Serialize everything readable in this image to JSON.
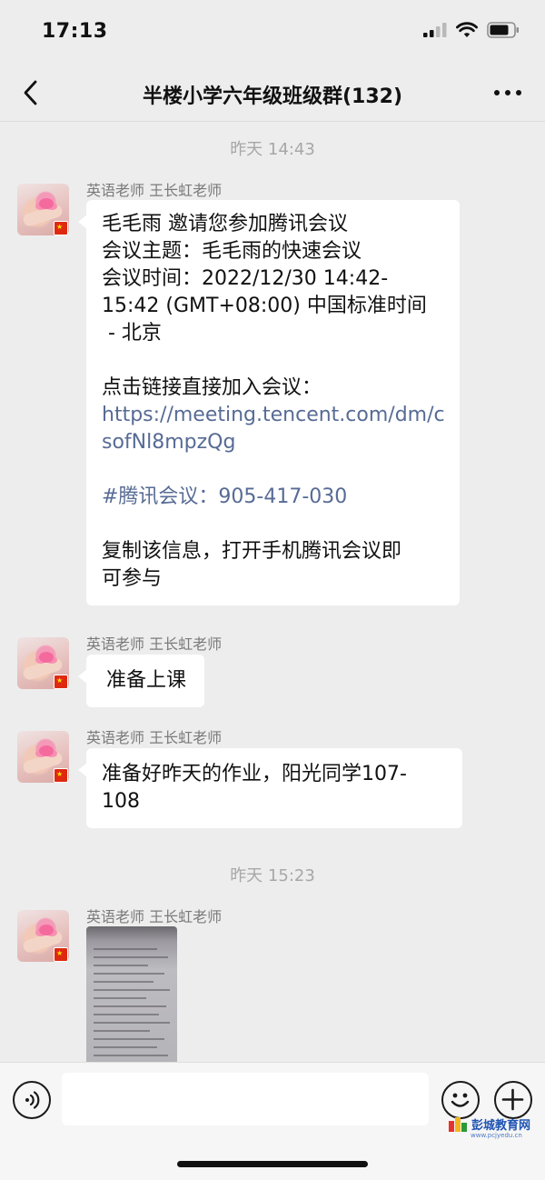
{
  "status_bar": {
    "time": "17:13"
  },
  "header": {
    "title": "半楼小学六年级班级群(132)"
  },
  "messages": [
    {
      "type": "time",
      "text": "昨天 14:43"
    },
    {
      "type": "text",
      "sender": "英语老师 王长虹老师",
      "lines": [
        "毛毛雨 邀请您参加腾讯会议",
        "会议主题：毛毛雨的快速会议",
        "会议时间：2022/12/30 14:42-",
        "15:42 (GMT+08:00) 中国标准时间",
        " - 北京",
        "",
        "点击链接直接加入会议：",
        "https://meeting.tencent.com/dm/c",
        "sofNl8mpzQg",
        "",
        "#腾讯会议：905-417-030",
        "",
        "复制该信息，打开手机腾讯会议即",
        "可参与"
      ]
    },
    {
      "type": "text",
      "sender": "英语老师 王长虹老师",
      "lines": [
        "准备上课"
      ]
    },
    {
      "type": "text",
      "sender": "英语老师 王长虹老师",
      "lines": [
        "准备好昨天的作业，阳光同学107-",
        "108"
      ]
    },
    {
      "type": "time",
      "text": "昨天 15:23"
    },
    {
      "type": "image",
      "sender": "英语老师 王长虹老师"
    }
  ],
  "input": {
    "placeholder": ""
  },
  "watermark": {
    "text": "彭城教育网",
    "url": "www.pcjyedu.cn"
  },
  "colors": {
    "background": "#ededed",
    "bubble": "#ffffff",
    "link": "#576b95",
    "meta_text": "#a7a7a7"
  },
  "icons": {
    "back": "chevron-left-icon",
    "more": "more-dots-icon",
    "voice": "voice-icon",
    "emoji": "emoji-icon",
    "plus": "plus-icon"
  }
}
